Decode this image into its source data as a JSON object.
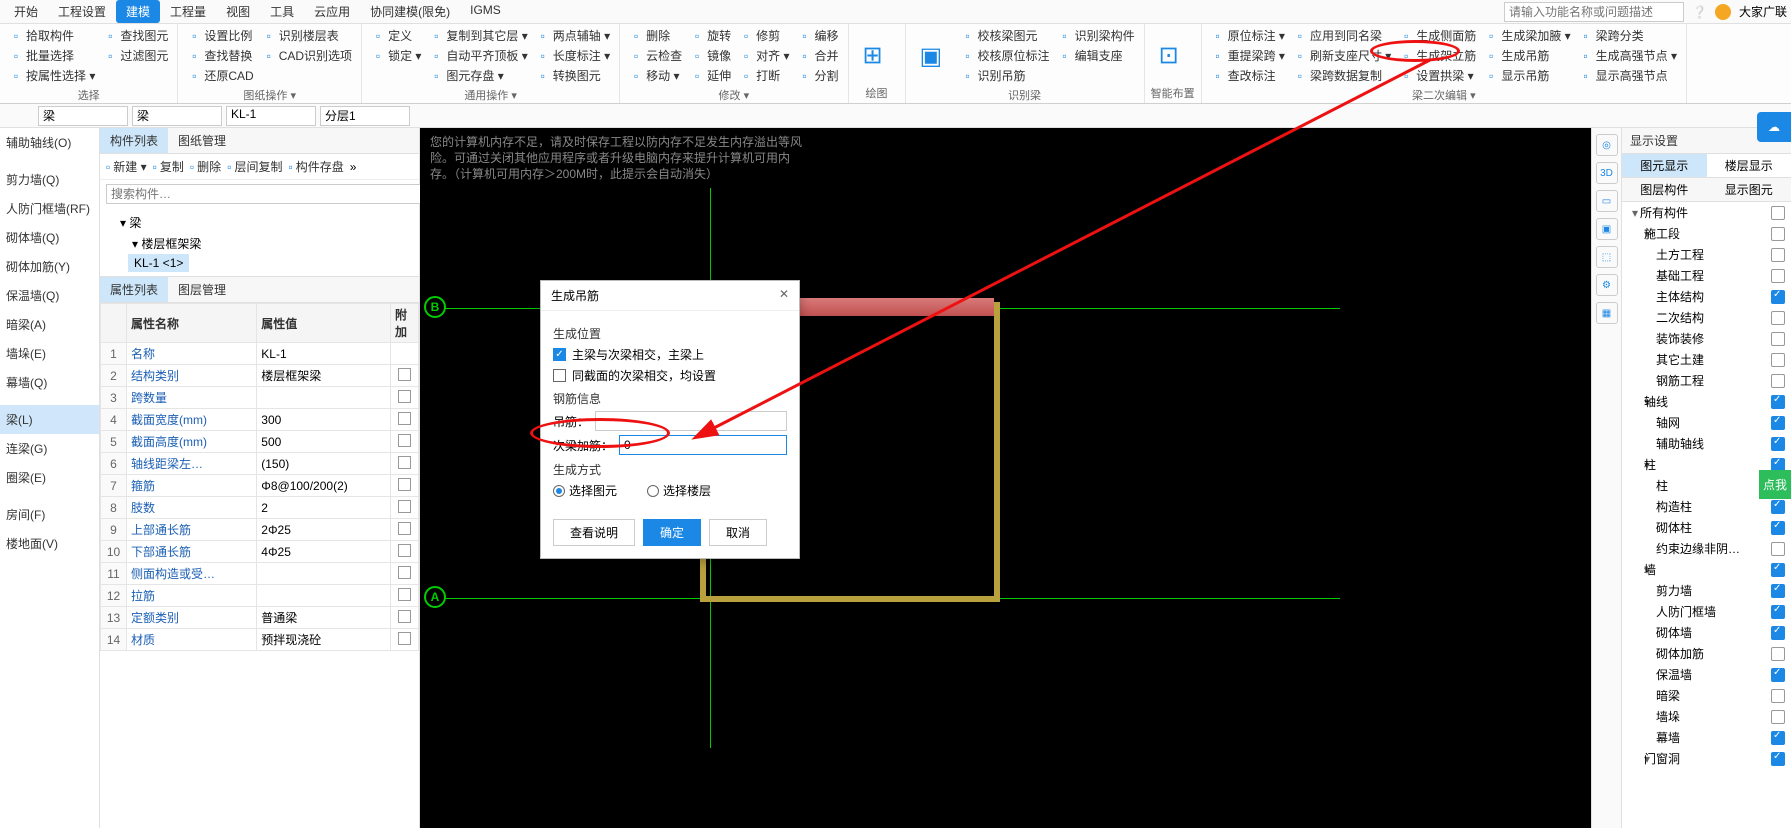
{
  "top_tabs": [
    "开始",
    "工程设置",
    "建模",
    "工程量",
    "视图",
    "工具",
    "云应用",
    "协同建模(限免)",
    "IGMS"
  ],
  "top_active": 2,
  "search_placeholder": "请输入功能名称或问题描述",
  "user_name": "大家广联",
  "ribbon": {
    "groups": [
      {
        "title": "选择",
        "cols": [
          [
            "拾取构件",
            "批量选择",
            "按属性选择 ▾"
          ],
          [
            "查找图元",
            "过滤图元"
          ]
        ]
      },
      {
        "title": "图纸操作 ▾",
        "cols": [
          [
            "设置比例",
            "查找替换",
            "还原CAD"
          ],
          [
            "识别楼层表",
            "CAD识别选项"
          ]
        ]
      },
      {
        "title": "通用操作 ▾",
        "cols": [
          [
            "定义",
            "锁定 ▾"
          ],
          [
            "复制到其它层 ▾",
            "自动平齐顶板 ▾",
            "图元存盘 ▾"
          ],
          [
            "两点辅轴 ▾",
            "长度标注 ▾",
            "转换图元"
          ]
        ]
      },
      {
        "title": "修改 ▾",
        "cols": [
          [
            "删除",
            "云检查",
            "移动 ▾"
          ],
          [
            "旋转",
            "镜像",
            "延伸"
          ],
          [
            "修剪",
            "对齐 ▾",
            "打断"
          ],
          [
            "编移",
            "合并",
            "分割"
          ]
        ]
      },
      {
        "title": "绘图",
        "big": "⊞"
      },
      {
        "title": "识别梁",
        "big": "▣",
        "cols": [
          [
            "校核梁图元",
            "校核原位标注",
            "识别吊筋"
          ],
          [
            "识别梁构件",
            "编辑支座"
          ]
        ]
      },
      {
        "title": "智能布置",
        "big": "⊡"
      },
      {
        "title": "梁二次编辑 ▾",
        "cols": [
          [
            "原位标注 ▾",
            "重提梁跨 ▾",
            "查改标注"
          ],
          [
            "应用到同名梁",
            "刷新支座尺寸 ▾",
            "梁跨数据复制"
          ],
          [
            "生成侧面筋",
            "生成架立筋",
            "设置拱梁 ▾"
          ],
          [
            "生成梁加腋 ▾",
            "生成吊筋",
            "显示吊筋"
          ],
          [
            "梁跨分类",
            "生成高强节点 ▾",
            "显示高强节点"
          ]
        ]
      }
    ]
  },
  "subbar": {
    "sel1": "梁",
    "sel2": "梁",
    "sel3": "KL-1",
    "sel4": "分层1"
  },
  "left_tree": [
    "辅助轴线(O)",
    "",
    "剪力墙(Q)",
    "人防门框墙(RF)",
    "砌体墙(Q)",
    "砌体加筋(Y)",
    "保温墙(Q)",
    "暗梁(A)",
    "墙垛(E)",
    "幕墙(Q)",
    "",
    "梁(L)",
    "连梁(G)",
    "圈梁(E)",
    "",
    "房间(F)",
    "楼地面(V)"
  ],
  "left_sel": 11,
  "comp_tabs": [
    "构件列表",
    "图纸管理"
  ],
  "comp_toolbar": [
    "新建 ▾",
    "复制",
    "删除",
    "层间复制",
    "构件存盘"
  ],
  "comp_search_ph": "搜索构件…",
  "comp_tree": {
    "root": "梁",
    "child": "楼层框架梁",
    "leaf": "KL-1 <1>"
  },
  "prop_tabs": [
    "属性列表",
    "图层管理"
  ],
  "prop_cols": [
    "属性名称",
    "属性值",
    "附加"
  ],
  "props": [
    {
      "n": "名称",
      "v": "KL-1"
    },
    {
      "n": "结构类别",
      "v": "楼层框架梁"
    },
    {
      "n": "跨数量",
      "v": ""
    },
    {
      "n": "截面宽度(mm)",
      "v": "300"
    },
    {
      "n": "截面高度(mm)",
      "v": "500"
    },
    {
      "n": "轴线距梁左…",
      "v": "(150)"
    },
    {
      "n": "箍筋",
      "v": "Φ8@100/200(2)"
    },
    {
      "n": "肢数",
      "v": "2"
    },
    {
      "n": "上部通长筋",
      "v": "2Φ25"
    },
    {
      "n": "下部通长筋",
      "v": "4Φ25"
    },
    {
      "n": "侧面构造或受…",
      "v": ""
    },
    {
      "n": "拉筋",
      "v": ""
    },
    {
      "n": "定额类别",
      "v": "普通梁"
    },
    {
      "n": "材质",
      "v": "预拌现浇砼"
    }
  ],
  "canvas_hint": "您的计算机内存不足，请及时保存工程以防内存不足发生内存溢出等风险。可通过关闭其他应用程序或者升级电脑内存来提升计算机可用内存。（计算机可用内存＞200M时，此提示会自动消失）",
  "axes": {
    "A": "A",
    "B": "B"
  },
  "right_strip": [
    "◎",
    "3D",
    "▭",
    "▣",
    "⬚",
    "⚙",
    "▦"
  ],
  "disp": {
    "title": "显示设置",
    "tabs": [
      "图元显示",
      "楼层显示"
    ],
    "cols": [
      "图层构件",
      "显示图元"
    ],
    "rows": [
      {
        "l": "所有构件",
        "lv": 0,
        "c": 0
      },
      {
        "l": "施工段",
        "lv": 1,
        "c": 0
      },
      {
        "l": "土方工程",
        "lv": 2,
        "c": 0
      },
      {
        "l": "基础工程",
        "lv": 2,
        "c": 0
      },
      {
        "l": "主体结构",
        "lv": 2,
        "c": 1
      },
      {
        "l": "二次结构",
        "lv": 2,
        "c": 0
      },
      {
        "l": "装饰装修",
        "lv": 2,
        "c": 0
      },
      {
        "l": "其它土建",
        "lv": 2,
        "c": 0
      },
      {
        "l": "钢筋工程",
        "lv": 2,
        "c": 0
      },
      {
        "l": "轴线",
        "lv": 1,
        "c": 1
      },
      {
        "l": "轴网",
        "lv": 2,
        "c": 1
      },
      {
        "l": "辅助轴线",
        "lv": 2,
        "c": 1
      },
      {
        "l": "柱",
        "lv": 1,
        "c": 1
      },
      {
        "l": "柱",
        "lv": 2,
        "c": 1
      },
      {
        "l": "构造柱",
        "lv": 2,
        "c": 1
      },
      {
        "l": "砌体柱",
        "lv": 2,
        "c": 1
      },
      {
        "l": "约束边缘非阴…",
        "lv": 2,
        "c": 0
      },
      {
        "l": "墙",
        "lv": 1,
        "c": 1
      },
      {
        "l": "剪力墙",
        "lv": 2,
        "c": 1
      },
      {
        "l": "人防门框墙",
        "lv": 2,
        "c": 1
      },
      {
        "l": "砌体墙",
        "lv": 2,
        "c": 1
      },
      {
        "l": "砌体加筋",
        "lv": 2,
        "c": 0
      },
      {
        "l": "保温墙",
        "lv": 2,
        "c": 1
      },
      {
        "l": "暗梁",
        "lv": 2,
        "c": 0
      },
      {
        "l": "墙垛",
        "lv": 2,
        "c": 0
      },
      {
        "l": "幕墙",
        "lv": 2,
        "c": 1
      },
      {
        "l": "门窗洞",
        "lv": 1,
        "c": 1
      }
    ],
    "green_btn": "点我"
  },
  "dialog": {
    "title": "生成吊筋",
    "sec1": "生成位置",
    "cb1": "主梁与次梁相交，主梁上",
    "cb2": "同截面的次梁相交，均设置",
    "sec2": "钢筋信息",
    "lbl1": "吊筋：",
    "lbl2": "次梁加筋：",
    "val2": "0",
    "sec3": "生成方式",
    "r1": "选择图元",
    "r2": "选择楼层",
    "btns": [
      "查看说明",
      "确定",
      "取消"
    ]
  }
}
